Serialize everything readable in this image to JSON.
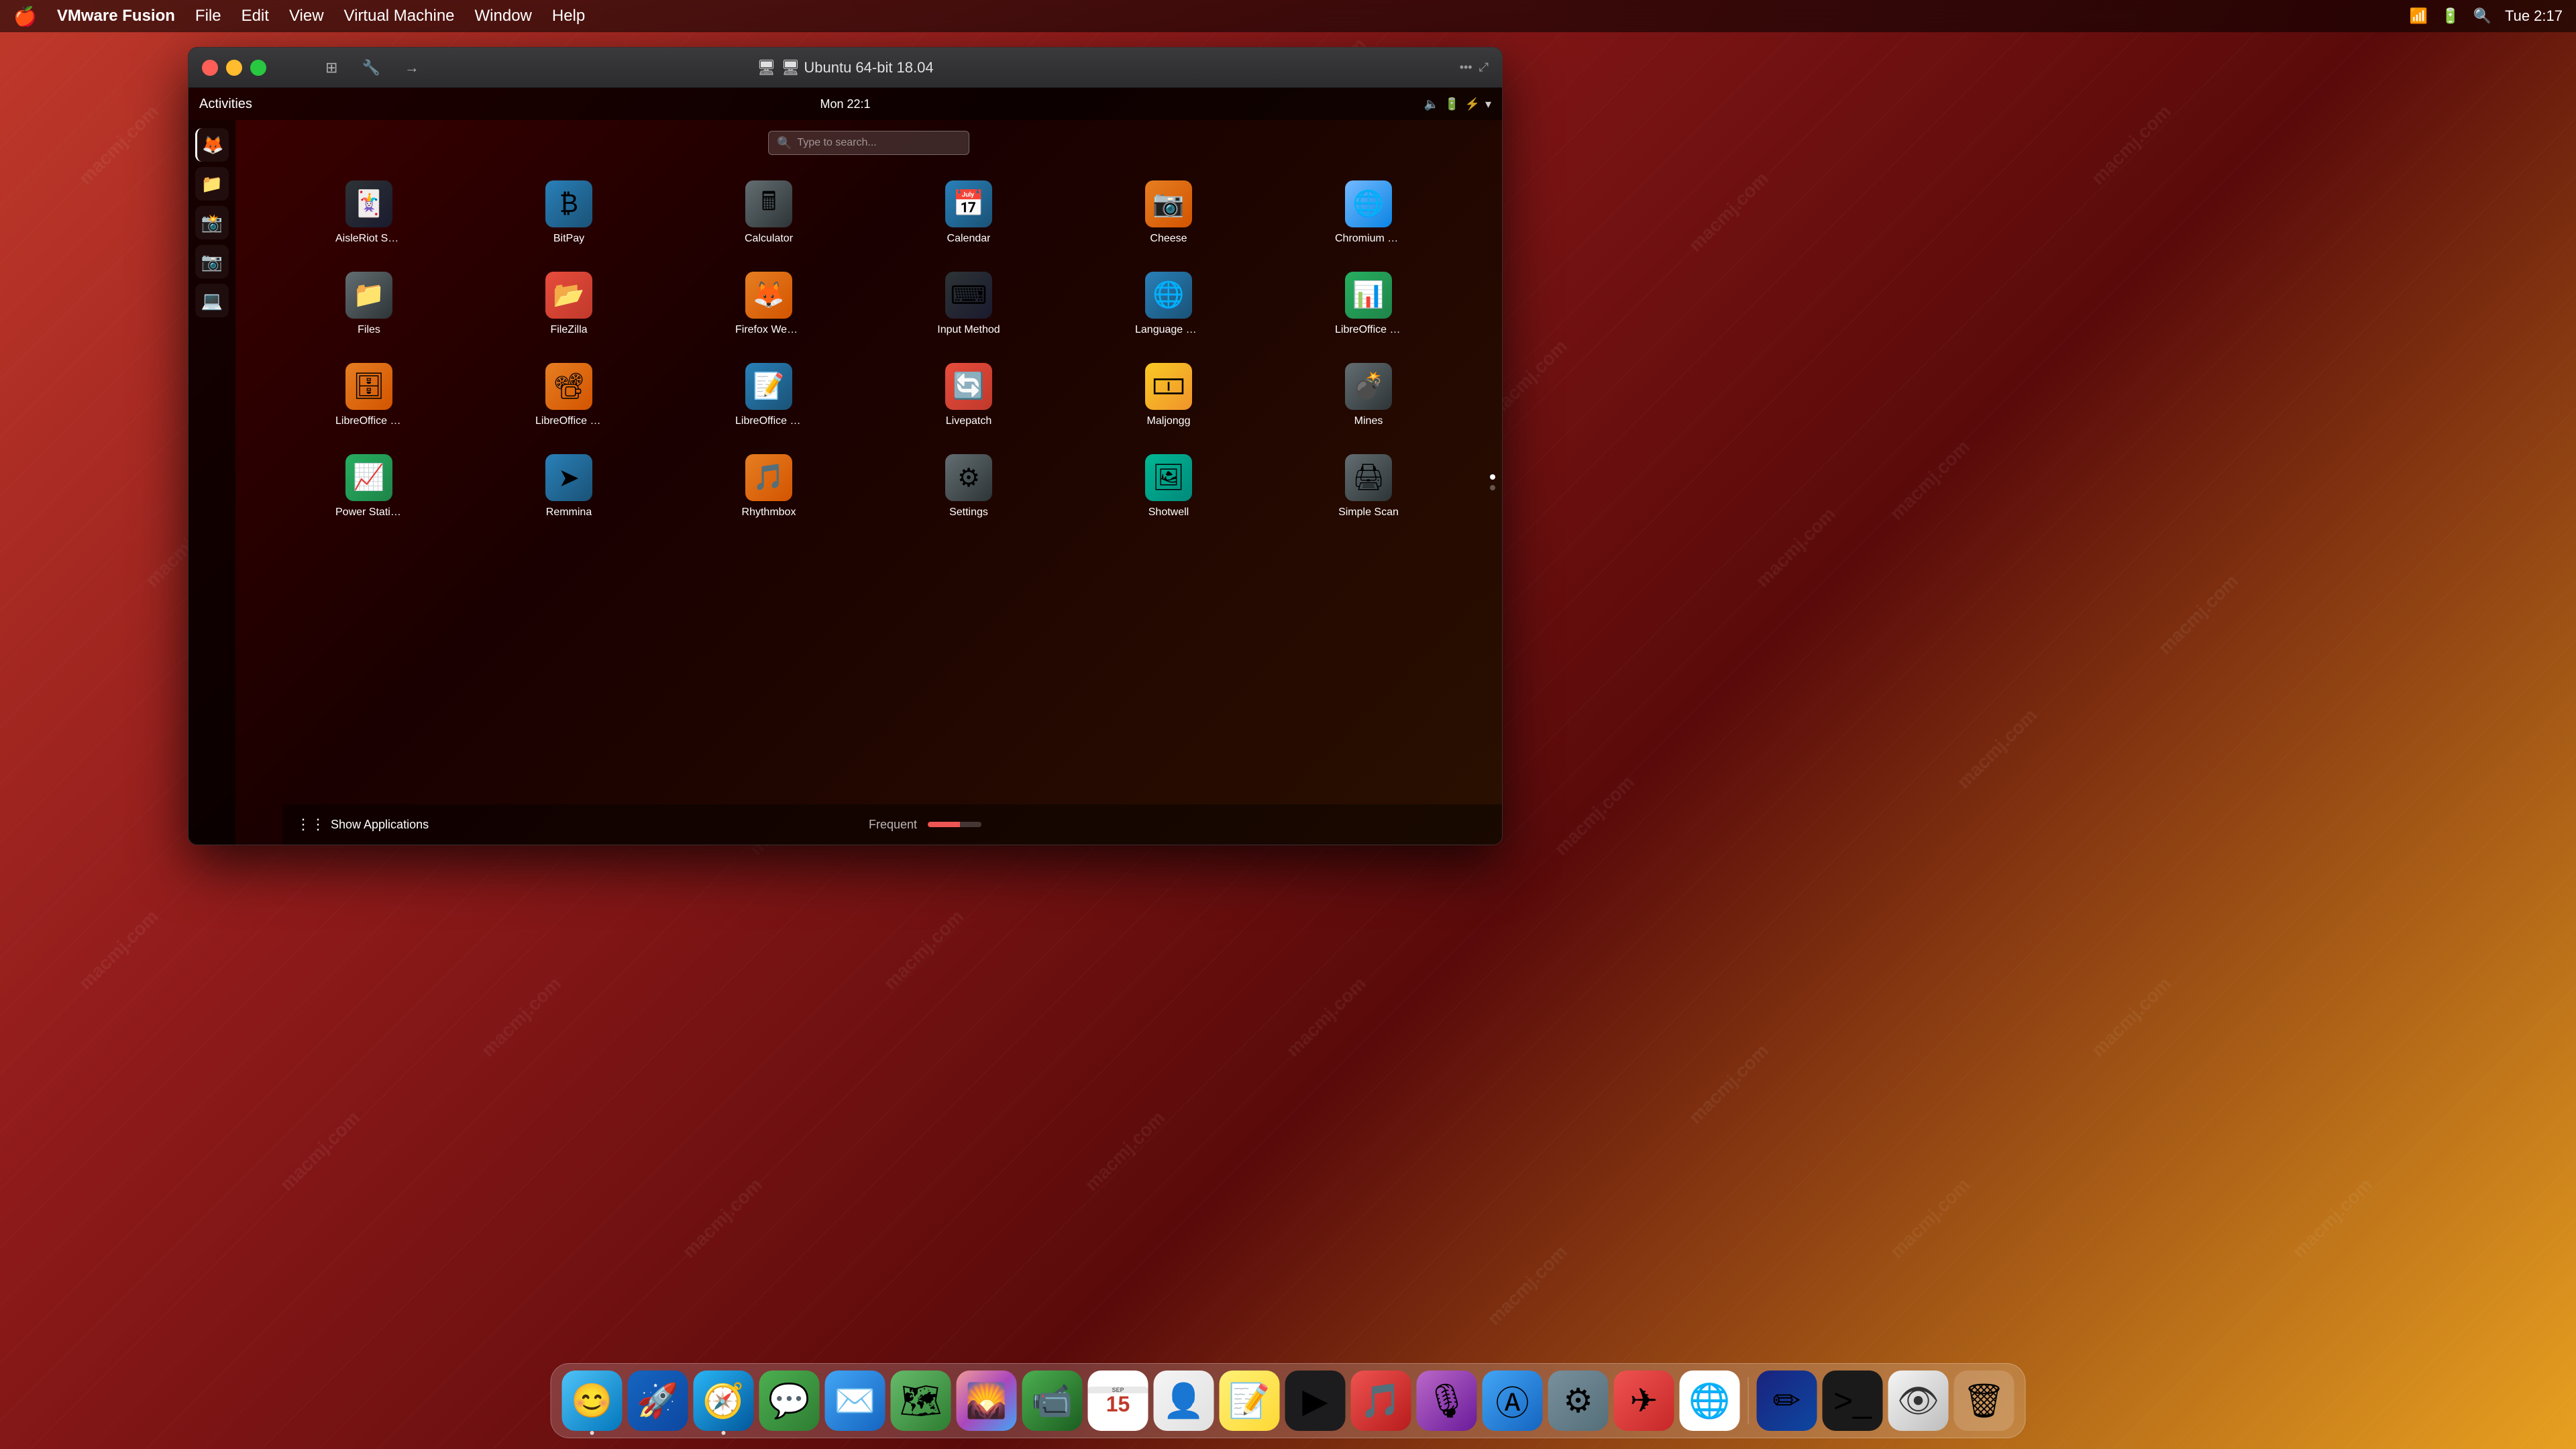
{
  "menubar": {
    "apple": "🍎",
    "items": [
      {
        "label": "VMware Fusion",
        "bold": true
      },
      {
        "label": "File"
      },
      {
        "label": "Edit"
      },
      {
        "label": "View"
      },
      {
        "label": "Virtual Machine"
      },
      {
        "label": "Window"
      },
      {
        "label": "Help"
      }
    ],
    "right_items": [
      "🌐",
      "🔋",
      "📶",
      "🔍",
      "Tue 2:17"
    ]
  },
  "vm_window": {
    "title": "🖥 Ubuntu 64-bit 18.04",
    "traffic_lights": {
      "close": "×",
      "minimize": "−",
      "maximize": "+"
    },
    "controls": [
      "⊞",
      "←",
      "→"
    ]
  },
  "ubuntu": {
    "topbar": {
      "activities": "Activities",
      "date": "Mon 22:1",
      "right_icons": [
        "🔈",
        "🔋",
        "⚡",
        "…"
      ]
    },
    "search": {
      "placeholder": "Type to search..."
    },
    "sidebar_icons": [
      "🦊",
      "📁",
      "📸",
      "📷",
      "💻"
    ],
    "apps": [
      {
        "name": "AisleRiot Solit...",
        "emoji": "🃏",
        "color": "icon-dark"
      },
      {
        "name": "BitPay",
        "emoji": "₿",
        "color": "icon-blue"
      },
      {
        "name": "Calculator",
        "emoji": "🖩",
        "color": "icon-gray"
      },
      {
        "name": "Calendar",
        "emoji": "📅",
        "color": "icon-blue"
      },
      {
        "name": "Cheese",
        "emoji": "📷",
        "color": "icon-orange"
      },
      {
        "name": "Chromium We...",
        "emoji": "🌐",
        "color": "icon-light-blue"
      },
      {
        "name": "Files",
        "emoji": "📁",
        "color": "icon-gray"
      },
      {
        "name": "FileZilla",
        "emoji": "📂",
        "color": "icon-red"
      },
      {
        "name": "Firefox Web B...",
        "emoji": "🦊",
        "color": "icon-orange"
      },
      {
        "name": "Input Method",
        "emoji": "⌨",
        "color": "icon-dark"
      },
      {
        "name": "Language Sup...",
        "emoji": "🌐",
        "color": "icon-blue"
      },
      {
        "name": "LibreOffice Calc",
        "emoji": "📊",
        "color": "icon-green"
      },
      {
        "name": "LibreOffice D...",
        "emoji": "🗄",
        "color": "icon-orange"
      },
      {
        "name": "LibreOffice Im...",
        "emoji": "📽",
        "color": "icon-orange"
      },
      {
        "name": "LibreOffice W...",
        "emoji": "📝",
        "color": "icon-blue"
      },
      {
        "name": "Livepatch",
        "emoji": "🔄",
        "color": "icon-red"
      },
      {
        "name": "Maljongg",
        "emoji": "🀱",
        "color": "icon-yellow"
      },
      {
        "name": "Mines",
        "emoji": "💣",
        "color": "icon-gray"
      },
      {
        "name": "Power Statis...",
        "emoji": "📈",
        "color": "icon-green"
      },
      {
        "name": "Remmina",
        "emoji": "➤",
        "color": "icon-blue"
      },
      {
        "name": "Rhythmbox",
        "emoji": "🎵",
        "color": "icon-orange"
      },
      {
        "name": "Settings",
        "emoji": "⚙",
        "color": "icon-gray"
      },
      {
        "name": "Shotwell",
        "emoji": "🖼",
        "color": "icon-teal"
      },
      {
        "name": "Simple Scan",
        "emoji": "🖨",
        "color": "icon-gray"
      }
    ],
    "bottom_bar": {
      "show_apps": "Show Applications",
      "frequency": "Frequent"
    },
    "page_dots": [
      "active",
      "inactive"
    ]
  },
  "dock": {
    "items": [
      {
        "name": "Finder",
        "emoji": "😊",
        "class": "dock-finder",
        "has_dot": true
      },
      {
        "name": "Launchpad",
        "emoji": "🚀",
        "class": "dock-launchpad"
      },
      {
        "name": "Safari",
        "emoji": "🧭",
        "class": "dock-safari",
        "has_dot": true
      },
      {
        "name": "Messages",
        "emoji": "💬",
        "class": "dock-messages"
      },
      {
        "name": "Mail",
        "emoji": "✉️",
        "class": "dock-mail"
      },
      {
        "name": "Maps",
        "emoji": "🗺",
        "class": "dock-maps"
      },
      {
        "name": "Photos",
        "emoji": "🌄",
        "class": "dock-photos"
      },
      {
        "name": "FaceTime",
        "emoji": "📹",
        "class": "dock-facetime"
      },
      {
        "name": "Calendar",
        "emoji": "15",
        "class": "dock-calendar",
        "special": "calendar"
      },
      {
        "name": "Contacts",
        "emoji": "👤",
        "class": "dock-contacts"
      },
      {
        "name": "Notes",
        "emoji": "📝",
        "class": "dock-notes"
      },
      {
        "name": "AppleTV",
        "emoji": "▶",
        "class": "dock-appletv"
      },
      {
        "name": "Music",
        "emoji": "🎵",
        "class": "dock-music"
      },
      {
        "name": "Podcasts",
        "emoji": "🎙",
        "class": "dock-podcasts"
      },
      {
        "name": "AppStore",
        "emoji": "Ⓐ",
        "class": "dock-appstore"
      },
      {
        "name": "SystemPreferences",
        "emoji": "⚙",
        "class": "dock-sysprefs"
      },
      {
        "name": "Airmail",
        "emoji": "✈",
        "class": "dock-airmail"
      },
      {
        "name": "Chrome",
        "emoji": "🌐",
        "class": "dock-chrome"
      },
      {
        "name": "Sketchbook",
        "emoji": "✏",
        "class": "dock-sketchbook"
      },
      {
        "name": "Terminal",
        "emoji": ">_",
        "class": "dock-terminal"
      },
      {
        "name": "Preview",
        "emoji": "👁",
        "class": "dock-preview"
      },
      {
        "name": "Trash",
        "emoji": "🗑",
        "class": "dock-trash"
      }
    ]
  },
  "watermarks": [
    "macmj.com",
    "macmj.com",
    "macmj.com"
  ]
}
